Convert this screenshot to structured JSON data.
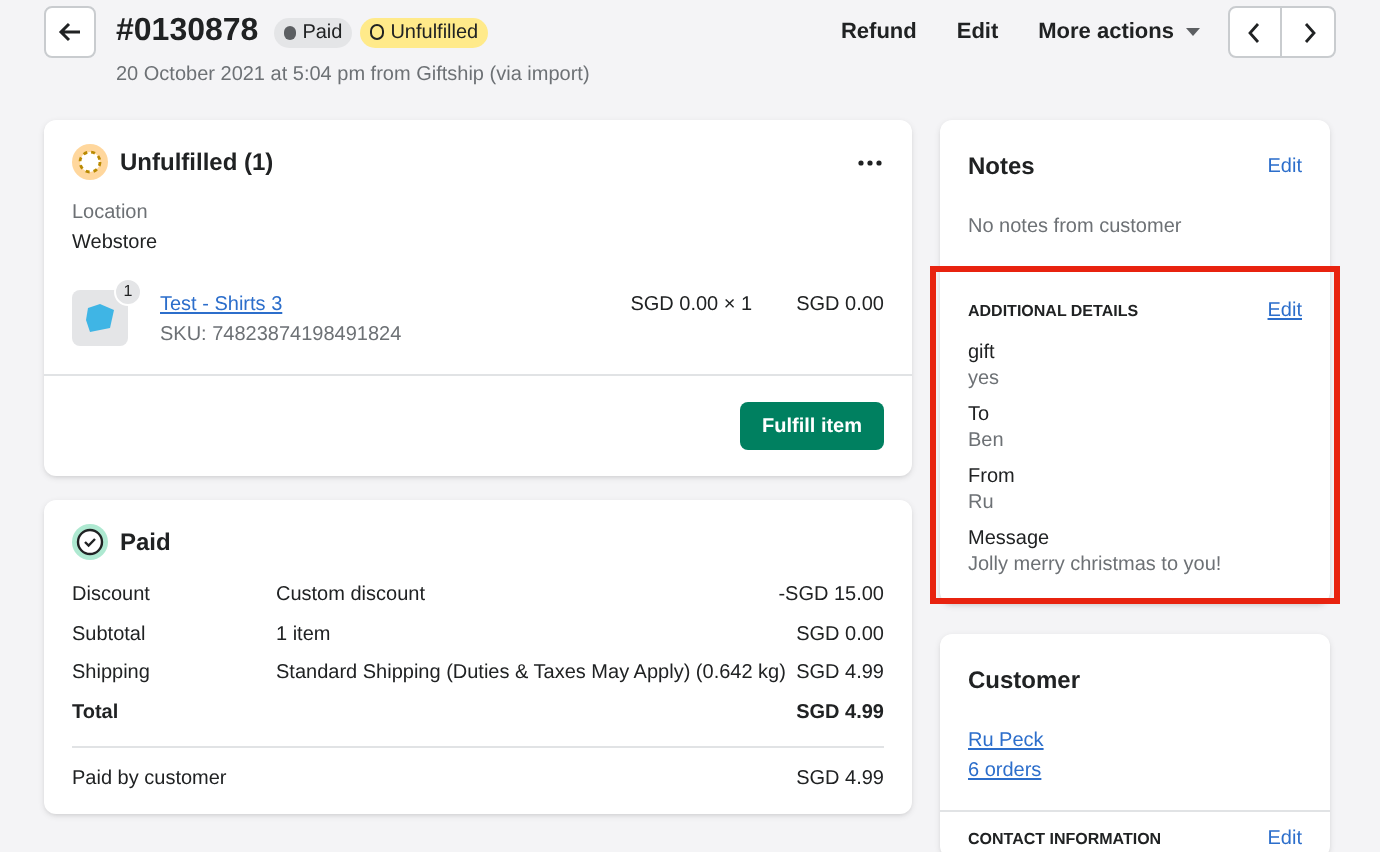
{
  "header": {
    "order": "#0130878",
    "badges": [
      {
        "kind": "paid",
        "label": "Paid"
      },
      {
        "kind": "unfulfilled",
        "label": "Unfulfilled"
      }
    ],
    "subtitle": "20 October 2021 at 5:04 pm from Giftship (via import)",
    "actions": [
      "Refund",
      "Edit"
    ],
    "more_actions": "More actions"
  },
  "fulfillment": {
    "title": "Unfulfilled (1)",
    "location_label": "Location",
    "location": "Webstore",
    "item": {
      "quantity_badge": "1",
      "name": "Test - Shirts 3",
      "sku": "SKU: 74823874198491824",
      "price": "SGD 0.00 × 1",
      "total": "SGD 0.00"
    },
    "button": "Fulfill item"
  },
  "payment": {
    "title": "Paid",
    "rows": [
      {
        "label": "Discount",
        "detail": "Custom discount",
        "amount": "-SGD 15.00",
        "bold": false
      },
      {
        "label": "Subtotal",
        "detail": "1 item",
        "amount": "SGD 0.00",
        "bold": false
      },
      {
        "label": "Shipping",
        "detail": "Standard Shipping (Duties & Taxes May Apply) (0.642 kg)",
        "amount": "SGD 4.99",
        "bold": false
      },
      {
        "label": "Total",
        "amount": "SGD 4.99",
        "bold": true
      }
    ],
    "paid_by_label": "Paid by customer",
    "paid_by_amount": "SGD 4.99"
  },
  "notes": {
    "title": "Notes",
    "edit": "Edit",
    "text": "No notes from customer"
  },
  "additional_details": {
    "title": "ADDITIONAL DETAILS",
    "edit": "Edit",
    "fields": [
      {
        "label": "gift",
        "value": "yes"
      },
      {
        "label": "To",
        "value": "Ben"
      },
      {
        "label": "From",
        "value": "Ru"
      },
      {
        "label": "Message",
        "value": "Jolly merry christmas to you!"
      }
    ]
  },
  "customer": {
    "title": "Customer",
    "name": "Ru Peck",
    "orders": "6 orders",
    "contact_title": "CONTACT INFORMATION",
    "contact_edit": "Edit"
  }
}
